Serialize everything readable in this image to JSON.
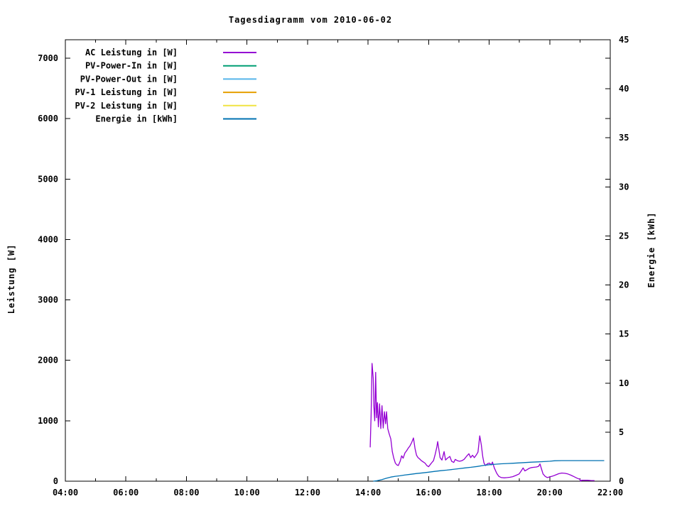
{
  "title": "Tagesdiagramm vom 2010-06-02",
  "colors": {
    "background": "#ffffff",
    "axis": "#000000",
    "ac_leistung": "#9400D3",
    "pv_power_in": "#009E73",
    "pv_power_out": "#56B4E9",
    "pv1_leistung": "#E69F00",
    "pv2_leistung": "#F0E442",
    "energie": "#0072B2"
  },
  "chart_data": {
    "type": "line",
    "title": "Tagesdiagramm vom 2010-06-02",
    "grid": false,
    "legend_position": "top-left-inside",
    "x_axis": {
      "unit": "time",
      "range_hours": [
        4,
        22
      ],
      "major_ticks_hours": [
        4,
        6,
        8,
        10,
        12,
        14,
        16,
        18,
        20,
        22
      ],
      "major_tick_labels": [
        "04:00",
        "06:00",
        "08:00",
        "10:00",
        "12:00",
        "14:00",
        "16:00",
        "18:00",
        "20:00",
        "22:00"
      ],
      "minor_ticks_hours": [
        5,
        7,
        9,
        11,
        13,
        15,
        17,
        19,
        21
      ]
    },
    "y_axis": {
      "label": "Leistung [W]",
      "range": [
        0,
        7300
      ],
      "ticks": [
        0,
        1000,
        2000,
        3000,
        4000,
        5000,
        6000,
        7000
      ]
    },
    "y2_axis": {
      "label": "Energie [kWh]",
      "range": [
        0,
        45
      ],
      "ticks": [
        0,
        5,
        10,
        15,
        20,
        25,
        30,
        35,
        40,
        45
      ]
    },
    "legend": [
      {
        "label": "AC Leistung in [W]",
        "color": "#9400D3"
      },
      {
        "label": "PV-Power-In in [W]",
        "color": "#009E73"
      },
      {
        "label": "PV-Power-Out in [W]",
        "color": "#56B4E9"
      },
      {
        "label": "PV-1 Leistung in [W]",
        "color": "#E69F00"
      },
      {
        "label": "PV-2 Leistung in [W]",
        "color": "#F0E442"
      },
      {
        "label": "Energie in [kWh]",
        "color": "#0072B2"
      }
    ],
    "series": [
      {
        "name": "AC Leistung in [W]",
        "axis": "y1",
        "color": "#9400D3",
        "points": [
          [
            14.07,
            560
          ],
          [
            14.1,
            1100
          ],
          [
            14.13,
            1950
          ],
          [
            14.17,
            1700
          ],
          [
            14.19,
            1250
          ],
          [
            14.22,
            1000
          ],
          [
            14.25,
            1800
          ],
          [
            14.28,
            1050
          ],
          [
            14.31,
            1300
          ],
          [
            14.34,
            900
          ],
          [
            14.38,
            1280
          ],
          [
            14.42,
            870
          ],
          [
            14.46,
            1250
          ],
          [
            14.5,
            880
          ],
          [
            14.54,
            1150
          ],
          [
            14.58,
            950
          ],
          [
            14.61,
            1150
          ],
          [
            14.65,
            870
          ],
          [
            14.7,
            780
          ],
          [
            14.75,
            700
          ],
          [
            14.8,
            490
          ],
          [
            14.85,
            380
          ],
          [
            14.9,
            300
          ],
          [
            14.95,
            270
          ],
          [
            15.0,
            260
          ],
          [
            15.06,
            330
          ],
          [
            15.11,
            420
          ],
          [
            15.16,
            380
          ],
          [
            15.22,
            470
          ],
          [
            15.27,
            500
          ],
          [
            15.33,
            550
          ],
          [
            15.38,
            580
          ],
          [
            15.44,
            640
          ],
          [
            15.5,
            715
          ],
          [
            15.55,
            540
          ],
          [
            15.6,
            430
          ],
          [
            15.65,
            390
          ],
          [
            15.7,
            370
          ],
          [
            15.76,
            340
          ],
          [
            15.82,
            320
          ],
          [
            15.88,
            300
          ],
          [
            15.94,
            260
          ],
          [
            16.0,
            240
          ],
          [
            16.06,
            280
          ],
          [
            16.11,
            310
          ],
          [
            16.16,
            340
          ],
          [
            16.22,
            450
          ],
          [
            16.27,
            560
          ],
          [
            16.3,
            655
          ],
          [
            16.34,
            520
          ],
          [
            16.38,
            390
          ],
          [
            16.44,
            350
          ],
          [
            16.51,
            490
          ],
          [
            16.56,
            350
          ],
          [
            16.62,
            380
          ],
          [
            16.7,
            410
          ],
          [
            16.76,
            330
          ],
          [
            16.83,
            310
          ],
          [
            16.88,
            360
          ],
          [
            16.95,
            340
          ],
          [
            17.02,
            330
          ],
          [
            17.1,
            340
          ],
          [
            17.17,
            360
          ],
          [
            17.25,
            410
          ],
          [
            17.33,
            455
          ],
          [
            17.39,
            390
          ],
          [
            17.45,
            430
          ],
          [
            17.51,
            390
          ],
          [
            17.57,
            430
          ],
          [
            17.63,
            480
          ],
          [
            17.69,
            750
          ],
          [
            17.74,
            600
          ],
          [
            17.79,
            400
          ],
          [
            17.83,
            300
          ],
          [
            17.88,
            260
          ],
          [
            17.95,
            290
          ],
          [
            18.01,
            300
          ],
          [
            18.07,
            270
          ],
          [
            18.11,
            316
          ],
          [
            18.17,
            220
          ],
          [
            18.25,
            130
          ],
          [
            18.32,
            80
          ],
          [
            18.4,
            60
          ],
          [
            18.5,
            55
          ],
          [
            18.6,
            60
          ],
          [
            18.68,
            65
          ],
          [
            18.78,
            75
          ],
          [
            18.88,
            95
          ],
          [
            18.99,
            120
          ],
          [
            19.06,
            170
          ],
          [
            19.12,
            220
          ],
          [
            19.18,
            170
          ],
          [
            19.25,
            190
          ],
          [
            19.33,
            215
          ],
          [
            19.4,
            225
          ],
          [
            19.48,
            230
          ],
          [
            19.56,
            235
          ],
          [
            19.63,
            245
          ],
          [
            19.68,
            285
          ],
          [
            19.73,
            200
          ],
          [
            19.78,
            120
          ],
          [
            19.85,
            80
          ],
          [
            19.92,
            60
          ],
          [
            20.0,
            70
          ],
          [
            20.1,
            85
          ],
          [
            20.2,
            105
          ],
          [
            20.3,
            125
          ],
          [
            20.4,
            135
          ],
          [
            20.5,
            130
          ],
          [
            20.6,
            120
          ],
          [
            20.7,
            100
          ],
          [
            20.8,
            75
          ],
          [
            20.9,
            50
          ],
          [
            21.0,
            30
          ],
          [
            21.02,
            0
          ],
          [
            21.05,
            15
          ],
          [
            21.15,
            15
          ],
          [
            21.25,
            15
          ],
          [
            21.35,
            12
          ],
          [
            21.48,
            10
          ]
        ]
      },
      {
        "name": "PV-Power-In in [W]",
        "axis": "y1",
        "color": "#009E73",
        "points": []
      },
      {
        "name": "PV-Power-Out in [W]",
        "axis": "y1",
        "color": "#56B4E9",
        "points": []
      },
      {
        "name": "PV-1 Leistung in [W]",
        "axis": "y1",
        "color": "#E69F00",
        "points": []
      },
      {
        "name": "PV-2 Leistung in [W]",
        "axis": "y1",
        "color": "#F0E442",
        "points": []
      },
      {
        "name": "Energie in [kWh]",
        "axis": "y2",
        "color": "#0072B2",
        "points": [
          [
            14.17,
            0
          ],
          [
            14.3,
            0.05
          ],
          [
            14.45,
            0.15
          ],
          [
            14.6,
            0.3
          ],
          [
            14.75,
            0.42
          ],
          [
            14.9,
            0.5
          ],
          [
            15.05,
            0.55
          ],
          [
            15.2,
            0.62
          ],
          [
            15.4,
            0.7
          ],
          [
            15.6,
            0.78
          ],
          [
            15.8,
            0.85
          ],
          [
            16.0,
            0.92
          ],
          [
            16.2,
            1.0
          ],
          [
            16.4,
            1.07
          ],
          [
            16.6,
            1.13
          ],
          [
            16.8,
            1.2
          ],
          [
            17.0,
            1.27
          ],
          [
            17.2,
            1.35
          ],
          [
            17.4,
            1.42
          ],
          [
            17.6,
            1.5
          ],
          [
            17.8,
            1.6
          ],
          [
            18.0,
            1.68
          ],
          [
            18.2,
            1.73
          ],
          [
            18.4,
            1.77
          ],
          [
            18.6,
            1.8
          ],
          [
            18.8,
            1.83
          ],
          [
            19.0,
            1.87
          ],
          [
            19.2,
            1.9
          ],
          [
            19.4,
            1.94
          ],
          [
            19.6,
            1.97
          ],
          [
            19.8,
            2.0
          ],
          [
            20.0,
            2.03
          ],
          [
            20.17,
            2.08
          ],
          [
            20.4,
            2.1
          ],
          [
            20.8,
            2.1
          ],
          [
            21.2,
            2.1
          ],
          [
            21.6,
            2.1
          ],
          [
            21.8,
            2.1
          ]
        ]
      }
    ]
  }
}
